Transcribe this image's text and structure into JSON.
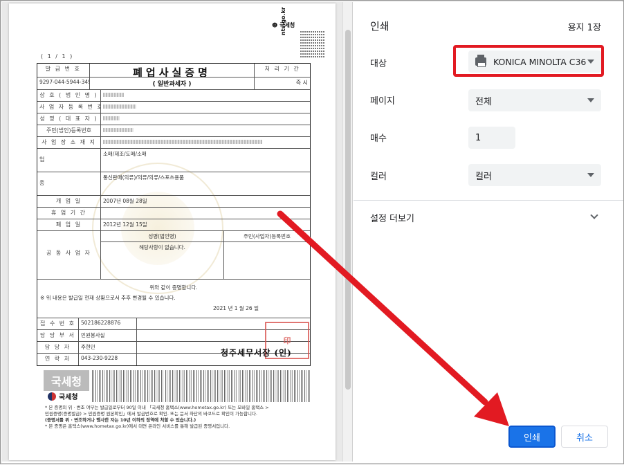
{
  "document": {
    "page_indicator": "( 1 / 1 )",
    "header_labels": {
      "issue_number_label": "발 급 번 호",
      "processing_period_label": "처 리 기 간",
      "processing_period_value": "즉 시"
    },
    "issue_number": "9297-044-5944-349",
    "title": "폐업사실증명",
    "subtitle": "( 일반과세자 )",
    "rows": {
      "company_name": "상 호 ( 법 인 명 )",
      "business_reg_no": "사 업 자 등 록 번 호",
      "name": "성 명 ( 대 표 자 )",
      "resident_no": "주민(법인)등록번호",
      "address": "사 업 장 소 재 지",
      "business_type": "업 태",
      "business_type_value": "소매/제조/도매/소매",
      "category": "종 목",
      "category_value": "통신판매(의류)/의류/의류/스포츠용품",
      "open_label": "개 업 일",
      "open_value": "2007년 08월 28일",
      "suspend_label": "휴 업 기 간",
      "close_label": "폐 업 일",
      "close_value": "2012년 12월 15일",
      "joint_label": "공 동 사 업 자",
      "joint_col_name": "성명(법인명)",
      "joint_col_id": "주민(사업자)등록번호",
      "joint_none": "해당사항이 없습니다."
    },
    "certify_text": "위와 같이 증명합니다.",
    "note_text": "※ 위 내용은 발급일 현재 상황으로서 추후 변경될 수 있습니다.",
    "issue_date": "2021 년 1 월 26 일",
    "receipt_label": "접 수 번 호",
    "receipt_value": "502186228876",
    "dept_label": "담 당 부 서",
    "dept_value": "민원봉사실",
    "staff_label": "담 당 자",
    "staff_value": "주현민",
    "contact_label": "연 락 처",
    "contact_value": "043-230-9228",
    "office_name": "청주세무서장 (인)",
    "nts_mark": "국세청",
    "nts_url_vertical": "nts.go.kr",
    "footer_logo": "국세청",
    "nts_logo_text": "국세청",
    "footer_lines": [
      "* 본 증명의 위 · 변조 여부는 발급일로부터 90일 이내 「국세청 홈택스(www.hometax.go.kr) 또는 모바일 홈택스 >",
      "민원증명(증명발급) > 민원증명 원본확인」에서 발급번호로 확인. 또는 문서 하단의 바코드로 확인이 가능합니다.",
      "(증명서를 위 · 변조하거나 행사한 자는 10년 이하의 징역에 처할 수 있습니다.)",
      "* 본 증명은 홈택스(www.hometax.go.kr)에서 대면 온라인 서비스를 통해 발급된 증명서입니다."
    ]
  },
  "print_dialog": {
    "title": "인쇄",
    "sheet_count": "용지 1장",
    "destination_label": "대상",
    "destination_value": "KONICA MINOLTA C36",
    "pages_label": "페이지",
    "pages_value": "전체",
    "copies_label": "매수",
    "copies_value": "1",
    "color_label": "컬러",
    "color_value": "컬러",
    "more_settings": "설정 더보기",
    "print_button": "인쇄",
    "cancel_button": "취소",
    "highlight_color": "#e21a22",
    "accent_color": "#1a73e8"
  }
}
